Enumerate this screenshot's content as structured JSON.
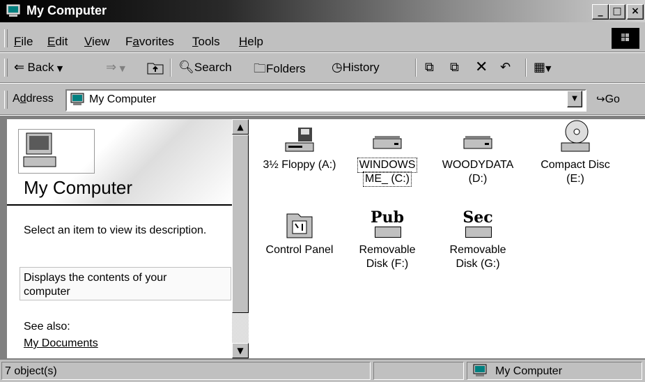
{
  "window": {
    "title": "My Computer",
    "icon": "computer-icon"
  },
  "caption_buttons": {
    "minimize": "_",
    "maximize": "□",
    "close": "×"
  },
  "menu": [
    {
      "label": "File",
      "u": "F",
      "rest": "ile"
    },
    {
      "label": "Edit",
      "u": "E",
      "rest": "dit"
    },
    {
      "label": "View",
      "u": "V",
      "rest": "iew"
    },
    {
      "label": "Favorites",
      "pre": "F",
      "u": "a",
      "rest": "vorites"
    },
    {
      "label": "Tools",
      "u": "T",
      "rest": "ools"
    },
    {
      "label": "Help",
      "u": "H",
      "rest": "elp"
    }
  ],
  "toolbar": {
    "back": "Back",
    "search": "Search",
    "folders": "Folders",
    "history": "History"
  },
  "address": {
    "label_pre": "A",
    "label_u": "d",
    "label_rest": "dress",
    "value": "My Computer",
    "go": "Go"
  },
  "left_panel": {
    "title": "My Computer",
    "prompt": "Select an item to view its description.",
    "description": "Displays the contents of your computer",
    "see_also": "See also:",
    "link": "My Documents"
  },
  "items": [
    {
      "line1": "3½ Floppy (A:)",
      "line2": "",
      "icon": "floppy-drive-icon"
    },
    {
      "line1": "WINDOWS",
      "line2": "ME_ (C:)",
      "icon": "hard-drive-icon",
      "selected": true
    },
    {
      "line1": "WOODYDATA",
      "line2": "(D:)",
      "icon": "hard-drive-icon"
    },
    {
      "line1": "Compact Disc",
      "line2": "(E:)",
      "icon": "cd-drive-icon"
    },
    {
      "line1": "Control Panel",
      "line2": "",
      "icon": "control-panel-icon"
    },
    {
      "line1": "Removable",
      "line2": "Disk (F:)",
      "icon": "removable-disk-icon",
      "badge": "Pub"
    },
    {
      "line1": "Removable",
      "line2": "Disk (G:)",
      "icon": "removable-disk-icon",
      "badge": "Sec"
    }
  ],
  "status": {
    "count": "7 object(s)",
    "zone": "My Computer"
  }
}
